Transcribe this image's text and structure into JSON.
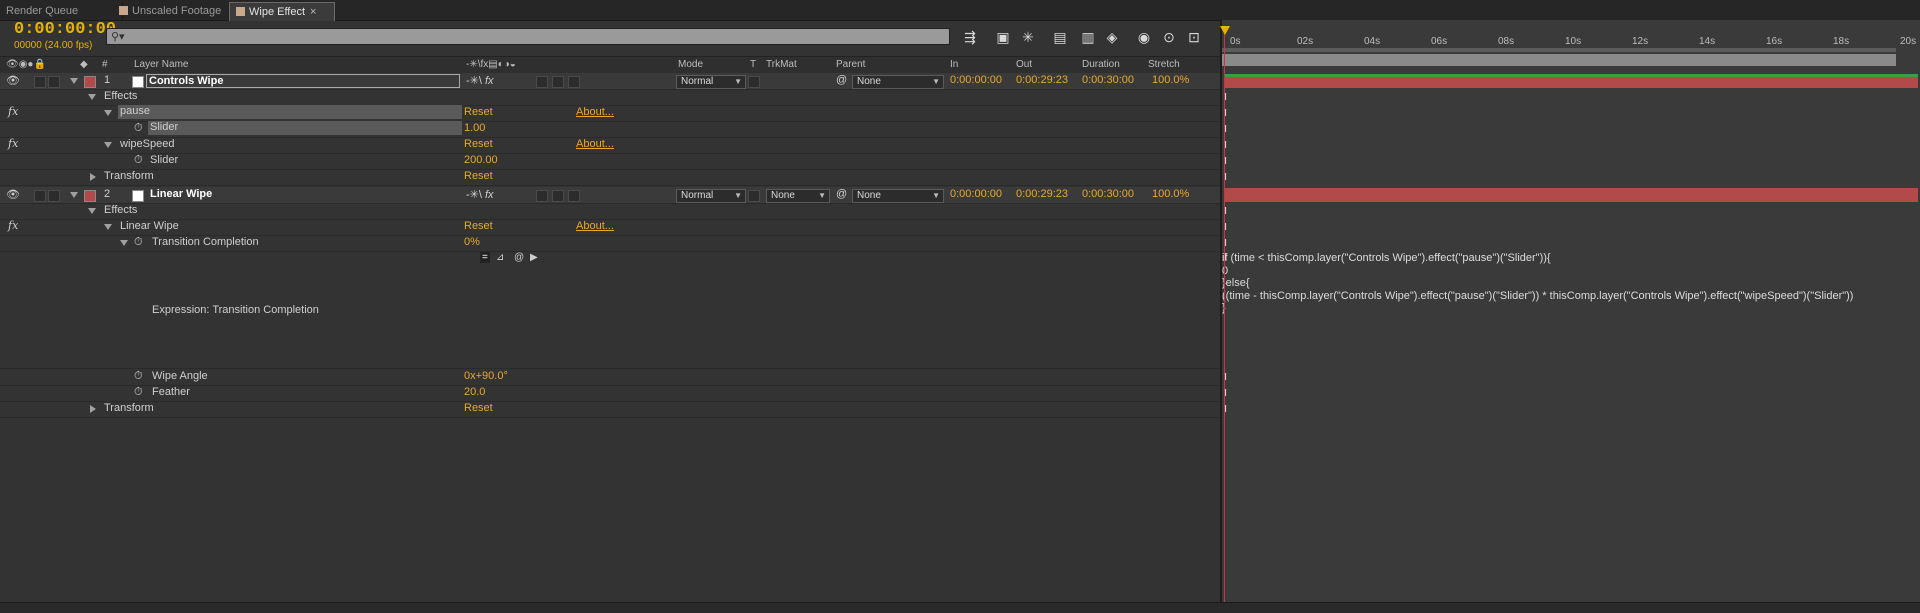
{
  "tabs": [
    {
      "label": "Render Queue"
    },
    {
      "label": "Unscaled Footage"
    },
    {
      "label": "Wipe Effect",
      "close": "×"
    }
  ],
  "header": {
    "timecode": "0:00:00:00",
    "frames": "00000 (24.00 fps)",
    "search_placeholder": ""
  },
  "toolbar_icons": [
    "composition-mini-flowchart-icon",
    "draft-3d-icon",
    "shy-layers-icon",
    "frame-blending-icon",
    "motion-blur-icon",
    "brainstorm-icon",
    "graph-editor-icon",
    "live-update-icon",
    "timeline-zoom-icon"
  ],
  "columns": {
    "num": "#",
    "layer_name": "Layer Name",
    "mode": "Mode",
    "t": "T",
    "trkmat": "TrkMat",
    "parent": "Parent",
    "in": "In",
    "out": "Out",
    "duration": "Duration",
    "stretch": "Stretch"
  },
  "layers": [
    {
      "num": "1",
      "name": "Controls Wipe",
      "mode": "Normal",
      "parent": "None",
      "in": "0:00:00:00",
      "out": "0:00:29:23",
      "duration": "0:00:30:00",
      "stretch": "100.0%",
      "label_color": "#b34a4a"
    },
    {
      "num": "2",
      "name": "Linear Wipe",
      "mode": "Normal",
      "trkmat": "None",
      "parent": "None",
      "in": "0:00:00:00",
      "out": "0:00:29:23",
      "duration": "0:00:30:00",
      "stretch": "100.0%",
      "label_color": "#b34a4a"
    }
  ],
  "props": {
    "effects1": "Effects",
    "pause": "pause",
    "pause_reset": "Reset",
    "pause_about": "About...",
    "slider1": "Slider",
    "slider1_val": "1.00",
    "wipespeed": "wipeSpeed",
    "wipespeed_reset": "Reset",
    "wipespeed_about": "About...",
    "slider2": "Slider",
    "slider2_val": "200.00",
    "transform1": "Transform",
    "transform1_reset": "Reset",
    "effects2": "Effects",
    "linearwipe": "Linear Wipe",
    "linearwipe_reset": "Reset",
    "linearwipe_about": "About...",
    "transition": "Transition Completion",
    "transition_val": "0%",
    "expr_label": "Expression: Transition Completion",
    "wipe_angle": "Wipe Angle",
    "wipe_angle_val": "0x+90.0°",
    "feather": "Feather",
    "feather_val": "20.0",
    "transform2": "Transform",
    "transform2_reset": "Reset"
  },
  "fx_symbol": "fx",
  "timeline": {
    "ticks": [
      "0s",
      "02s",
      "04s",
      "06s",
      "08s",
      "10s",
      "12s",
      "14s",
      "16s",
      "18s",
      "20s"
    ],
    "keyframe_glyph": "I",
    "expression_lines": [
      "if (time < thisComp.layer(\"Controls Wipe\").effect(\"pause\")(\"Slider\")){",
      "0",
      "}else{",
      "((time - thisComp.layer(\"Controls Wipe\").effect(\"pause\")(\"Slider\")) * thisComp.layer(\"Controls Wipe\").effect(\"wipeSpeed\")(\"Slider\"))",
      "}"
    ]
  },
  "colors": {
    "accent": "#e8a82c",
    "layer_bar": "#b34a4a",
    "playhead": "#e8b200"
  }
}
